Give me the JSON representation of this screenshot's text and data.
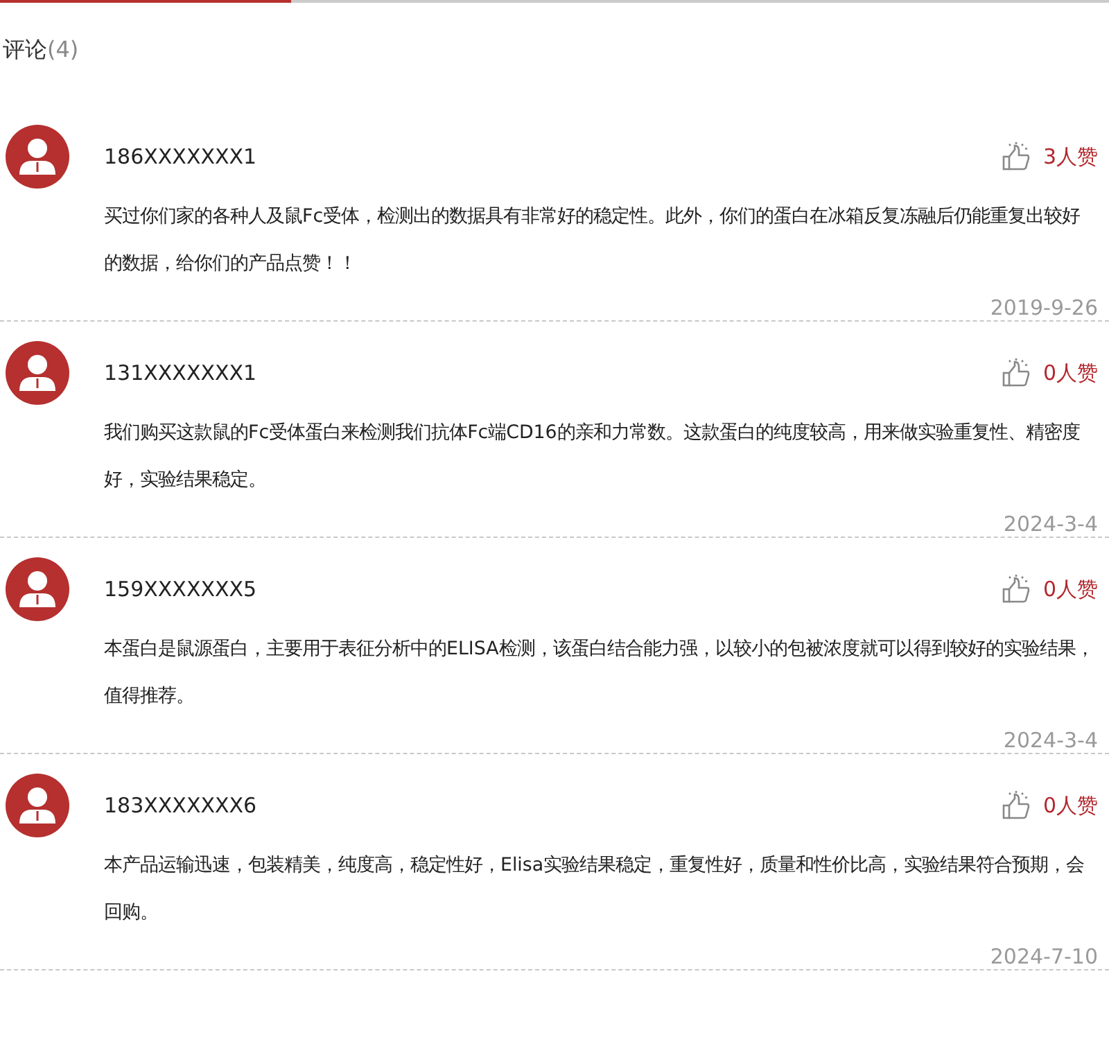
{
  "header": {
    "title": "评论",
    "count": "(4)"
  },
  "comments": [
    {
      "user": "186XXXXXXX1",
      "likes": "3人赞",
      "text": "买过你们家的各种人及鼠Fc受体，检测出的数据具有非常好的稳定性。此外，你们的蛋白在冰箱反复冻融后仍能重复出较好的数据，给你们的产品点赞！！",
      "date": "2019-9-26"
    },
    {
      "user": "131XXXXXXX1",
      "likes": "0人赞",
      "text": "我们购买这款鼠的Fc受体蛋白来检测我们抗体Fc端CD16的亲和力常数。这款蛋白的纯度较高，用来做实验重复性、精密度好，实验结果稳定。",
      "date": "2024-3-4"
    },
    {
      "user": "159XXXXXXX5",
      "likes": "0人赞",
      "text": "本蛋白是鼠源蛋白，主要用于表征分析中的ELISA检测，该蛋白结合能力强，以较小的包被浓度就可以得到较好的实验结果，值得推荐。",
      "date": "2024-3-4"
    },
    {
      "user": "183XXXXXXX6",
      "likes": "0人赞",
      "text": "本产品运输迅速，包装精美，纯度高，稳定性好，Elisa实验结果稳定，重复性好，质量和性价比高，实验结果符合预期，会回购。",
      "date": "2024-7-10"
    }
  ]
}
